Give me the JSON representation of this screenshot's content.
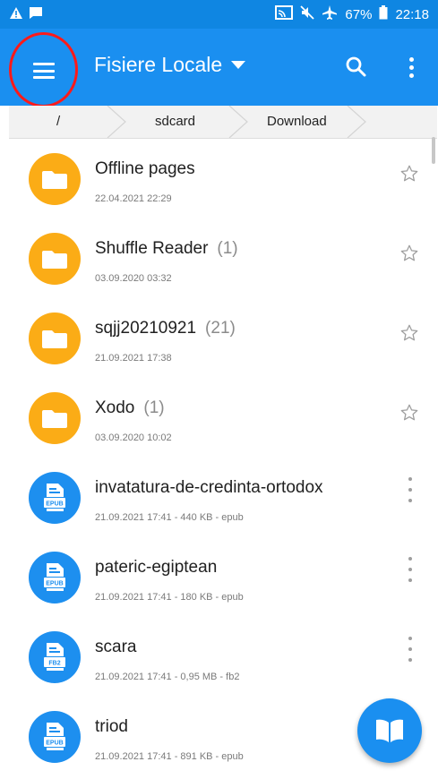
{
  "status_bar": {
    "battery": "67%",
    "time": "22:18",
    "left_icons": [
      "warning-icon",
      "message-icon"
    ],
    "right_icons": [
      "cast-icon",
      "mute-icon",
      "airplane-icon",
      "battery-icon"
    ]
  },
  "app_bar": {
    "menu_icon": "hamburger-menu-icon",
    "title": "Fisiere Locale",
    "dropdown_icon": "caret-down-icon",
    "search_icon": "search-icon",
    "more_icon": "more-vert-icon"
  },
  "breadcrumb": {
    "items": [
      "/",
      "sdcard",
      "Download"
    ]
  },
  "files": [
    {
      "name": "Offline pages",
      "count": "",
      "meta": "22.04.2021 22:29",
      "type": "folder",
      "action": "star"
    },
    {
      "name": "Shuffle Reader",
      "count": "(1)",
      "meta": "03.09.2020 03:32",
      "type": "folder",
      "action": "star"
    },
    {
      "name": "sqjj20210921",
      "count": "(21)",
      "meta": "21.09.2021 17:38",
      "type": "folder",
      "action": "star"
    },
    {
      "name": "Xodo",
      "count": "(1)",
      "meta": "03.09.2020 10:02",
      "type": "folder",
      "action": "star"
    },
    {
      "name": "invatatura-de-credinta-ortodox",
      "count": "",
      "meta": "21.09.2021 17:41 - 440 KB - epub",
      "type": "book",
      "badge": "EPUB",
      "action": "more"
    },
    {
      "name": "pateric-egiptean",
      "count": "",
      "meta": "21.09.2021 17:41 - 180 KB - epub",
      "type": "book",
      "badge": "EPUB",
      "action": "more"
    },
    {
      "name": "scara",
      "count": "",
      "meta": "21.09.2021 17:41 - 0,95 MB - fb2",
      "type": "book",
      "badge": "FB2",
      "action": "more"
    },
    {
      "name": "triod",
      "count": "",
      "meta": "21.09.2021 17:41 - 891 KB - epub",
      "type": "book",
      "badge": "EPUB",
      "action": "none"
    }
  ],
  "fab": {
    "icon": "open-book-icon"
  },
  "colors": {
    "status_bar": "#0f86e2",
    "app_bar": "#1a8ff0",
    "folder": "#fbac16",
    "book": "#1d8fef",
    "highlight_ring": "#ff1a1a"
  }
}
